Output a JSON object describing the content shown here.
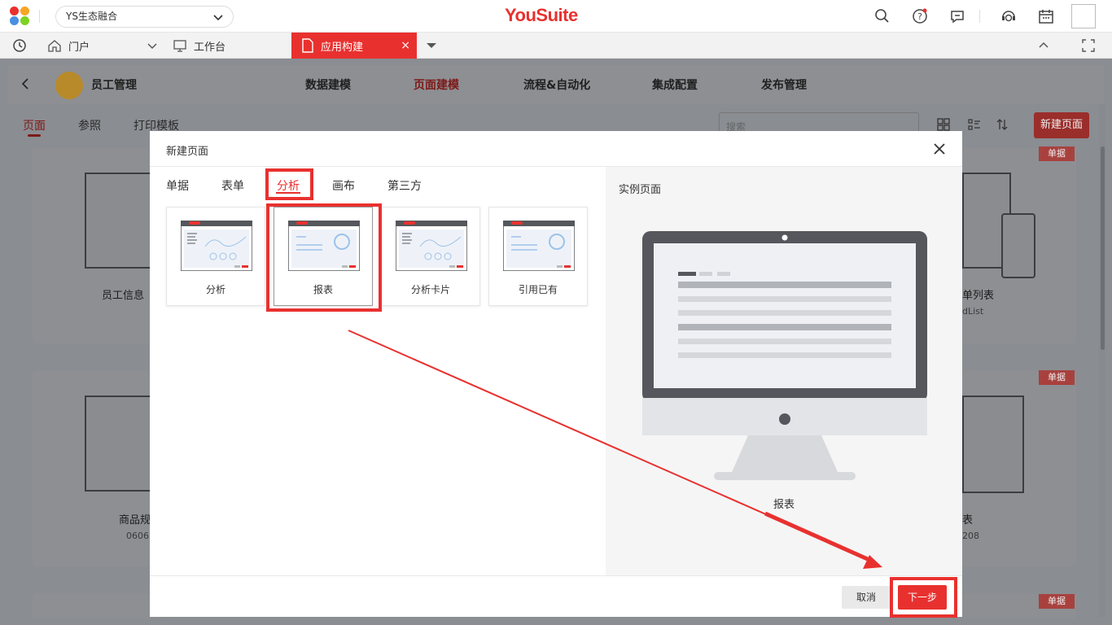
{
  "topbar": {
    "tenant": "YS生态融合",
    "brand_you": "You",
    "brand_suite": "Suite"
  },
  "tabs": {
    "portal": "门户",
    "workbench": "工作台",
    "active": "应用构建",
    "close": "×"
  },
  "app": {
    "name": "员工管理",
    "nav": [
      "数据建模",
      "页面建模",
      "流程&自动化",
      "集成配置",
      "发布管理"
    ],
    "active_nav": "页面建模",
    "subtabs": [
      "页面",
      "参照",
      "打印模板"
    ],
    "search_placeholder": "搜索",
    "new_page": "新建页面"
  },
  "bg_cards": {
    "tag": "单据",
    "labels": [
      "员工信息",
      "单列表",
      "dList",
      "商品规",
      "0606",
      "表",
      "208"
    ]
  },
  "modal": {
    "title": "新建页面",
    "categories": [
      "单据",
      "表单",
      "分析",
      "画布",
      "第三方"
    ],
    "active_category": "分析",
    "templates": [
      "分析",
      "报表",
      "分析卡片",
      "引用已有"
    ],
    "selected_template": "报表",
    "example_label": "实例页面",
    "preview_caption": "报表",
    "cancel": "取消",
    "next": "下一步"
  },
  "colors": {
    "accent": "#e8312f",
    "overlay": "#8a8d92"
  }
}
